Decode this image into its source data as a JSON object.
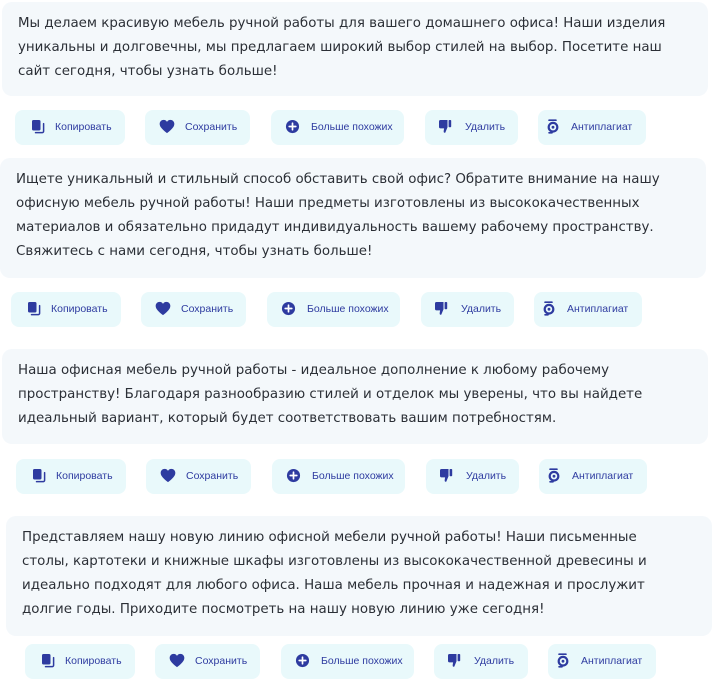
{
  "accent_color": "#2e3ba0",
  "button_bg_color": "#e9f9fb",
  "card_bg_color": "#f4f8fb",
  "results": [
    {
      "text": "Мы делаем красивую мебель ручной работы для вашего домашнего офиса! Наши изделия уникальны и долговечны, мы предлагаем широкий выбор стилей на выбор. Посетите наш сайт сегодня, чтобы узнать больше!",
      "actions": {
        "copy": "Копировать",
        "save": "Сохранить",
        "more_like": "Больше похожих",
        "delete": "Удалить",
        "antiplagiat": "Антиплагиат"
      }
    },
    {
      "text": "Ищете уникальный и стильный способ обставить свой офис? Обратите внимание на нашу офисную мебель ручной работы! Наши предметы изготовлены из высококачественных материалов и обязательно придадут индивидуальность вашему рабочему пространству. Свяжитесь с нами сегодня, чтобы узнать больше!",
      "actions": {
        "copy": "Копировать",
        "save": "Сохранить",
        "more_like": "Больше похожих",
        "delete": "Удалить",
        "antiplagiat": "Антиплагиат"
      }
    },
    {
      "text": "Наша офисная мебель ручной работы - идеальное дополнение к любому рабочему пространству! Благодаря разнообразию стилей и отделок мы уверены, что вы найдете идеальный вариант, который будет соответствовать вашим потребностям.",
      "actions": {
        "copy": "Копировать",
        "save": "Сохранить",
        "more_like": "Больше похожих",
        "delete": "Удалить",
        "antiplagiat": "Антиплагиат"
      }
    },
    {
      "text": "Представляем нашу новую линию офисной мебели ручной работы! Наши письменные столы, картотеки и книжные шкафы изготовлены из высококачественной древесины и идеально подходят для любого офиса. Наша мебель прочная и надежная и прослужит долгие годы. Приходите посмотреть на нашу новую линию уже сегодня!",
      "actions": {
        "copy": "Копировать",
        "save": "Сохранить",
        "more_like": "Больше похожих",
        "delete": "Удалить",
        "antiplagiat": "Антиплагиат"
      }
    }
  ]
}
